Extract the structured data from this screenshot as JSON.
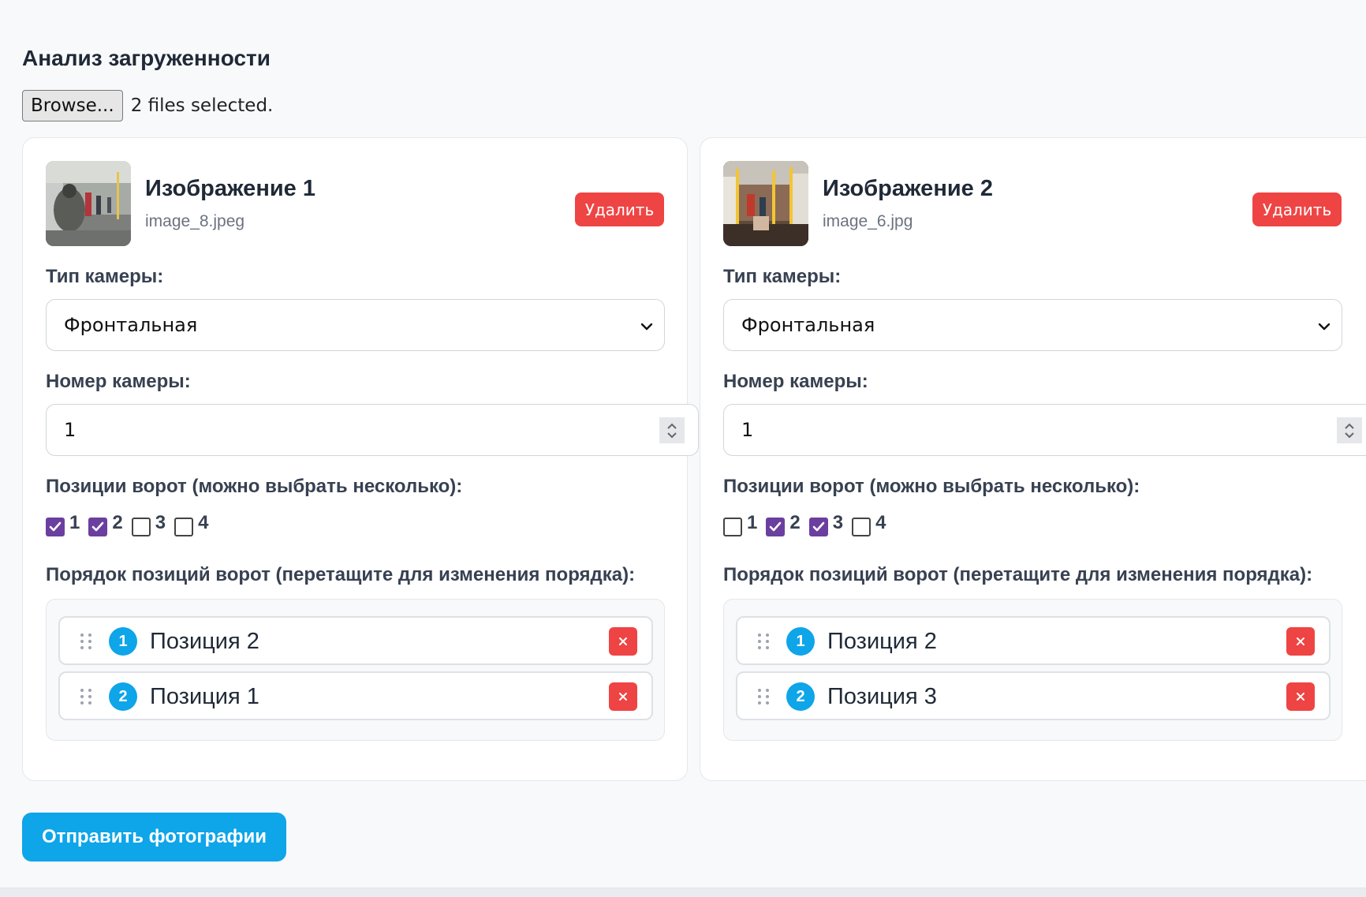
{
  "page": {
    "title": "Анализ загруженности"
  },
  "file_input": {
    "button_label": "Browse...",
    "status": "2 files selected."
  },
  "labels": {
    "camera_type": "Тип камеры:",
    "camera_number": "Номер камеры:",
    "gate_positions": "Позиции ворот (можно выбрать несколько):",
    "gate_order": "Порядок позиций ворот (перетащите для изменения порядка):"
  },
  "cards": [
    {
      "title": "Изображение 1",
      "filename": "image_8.jpeg",
      "delete_label": "Удалить",
      "camera_type": "Фронтальная",
      "camera_number": "1",
      "checkboxes": [
        {
          "label": "1",
          "checked": true
        },
        {
          "label": "2",
          "checked": true
        },
        {
          "label": "3",
          "checked": false
        },
        {
          "label": "4",
          "checked": false
        }
      ],
      "order": [
        {
          "index": "1",
          "label": "Позиция 2"
        },
        {
          "index": "2",
          "label": "Позиция 1"
        }
      ]
    },
    {
      "title": "Изображение 2",
      "filename": "image_6.jpg",
      "delete_label": "Удалить",
      "camera_type": "Фронтальная",
      "camera_number": "1",
      "checkboxes": [
        {
          "label": "1",
          "checked": false
        },
        {
          "label": "2",
          "checked": true
        },
        {
          "label": "3",
          "checked": true
        },
        {
          "label": "4",
          "checked": false
        }
      ],
      "order": [
        {
          "index": "1",
          "label": "Позиция 2"
        },
        {
          "index": "2",
          "label": "Позиция 3"
        }
      ]
    }
  ],
  "submit": {
    "label": "Отправить фотографии"
  },
  "colors": {
    "accent": "#0ea5e9",
    "danger": "#ef4444",
    "checkbox_checked": "#6b3fa0",
    "page_bg": "#f8f9fb"
  },
  "icons": {
    "select_caret": "chevron-down-icon",
    "number_spinner": "spinner-arrows-icon",
    "drag_handle": "drag-handle-icon",
    "remove": "close-icon",
    "checkbox_mark": "check-icon"
  }
}
